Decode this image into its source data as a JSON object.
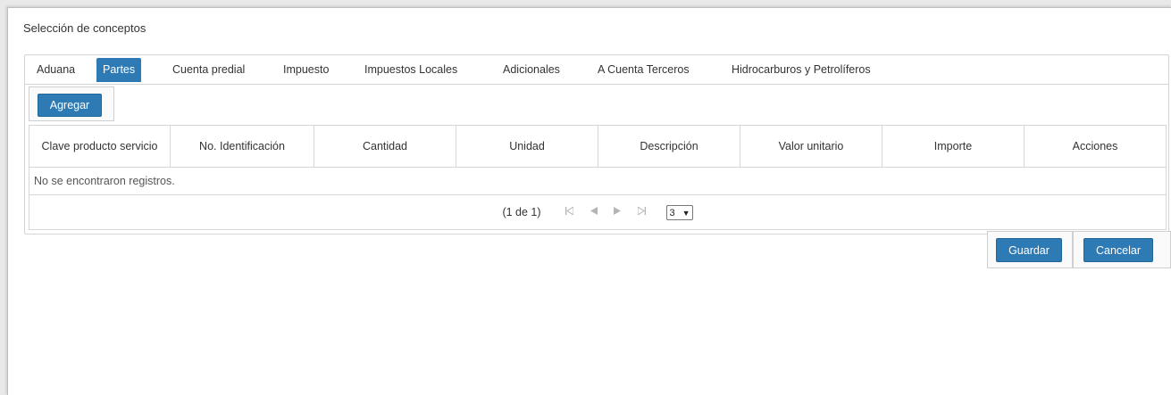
{
  "dialog": {
    "title": "Selección de conceptos"
  },
  "tabs": [
    {
      "label": "Aduana"
    },
    {
      "label": "Partes"
    },
    {
      "label": "Cuenta predial"
    },
    {
      "label": "Impuesto"
    },
    {
      "label": "Impuestos Locales"
    },
    {
      "label": "Adicionales"
    },
    {
      "label": "A Cuenta Terceros"
    },
    {
      "label": "Hidrocarburos y Petrolíferos"
    }
  ],
  "active_tab": "Partes",
  "toolbar": {
    "add_label": "Agregar"
  },
  "table": {
    "columns": [
      {
        "label": "Clave producto servicio"
      },
      {
        "label": "No. Identificación"
      },
      {
        "label": "Cantidad"
      },
      {
        "label": "Unidad"
      },
      {
        "label": "Descripción"
      },
      {
        "label": "Valor unitario"
      },
      {
        "label": "Importe"
      },
      {
        "label": "Acciones"
      }
    ],
    "empty_message": "No se encontraron registros."
  },
  "pager": {
    "report": "(1 de 1)",
    "first_icon": "first-page-icon",
    "prev_icon": "prev-page-icon",
    "next_icon": "next-page-icon",
    "last_icon": "last-page-icon",
    "rows_per_page": "3"
  },
  "footer": {
    "save_label": "Guardar",
    "cancel_label": "Cancelar"
  },
  "colors": {
    "accent": "#2e7ab5",
    "border": "#d4d4d4"
  }
}
